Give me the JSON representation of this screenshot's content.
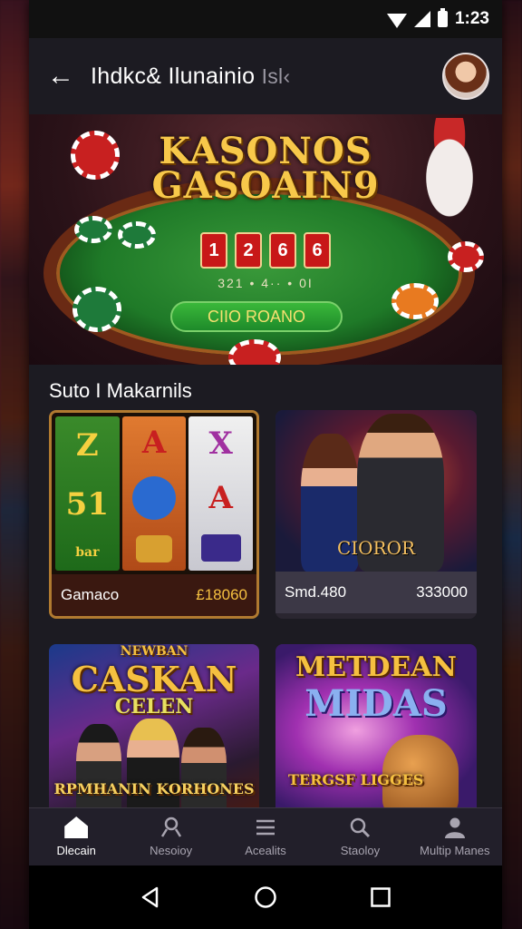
{
  "status": {
    "time": "1:23"
  },
  "appbar": {
    "title": "Ihdkc& Ilunainio",
    "title_suffix": "Isl‹"
  },
  "hero": {
    "title_line1": "KASONOS",
    "title_line2": "GASOAIN9",
    "dice": [
      "1",
      "2",
      "6",
      "6"
    ],
    "odds_text": "321 • 4·· • 0I",
    "button": "CIIO ROANO"
  },
  "section": {
    "title": "Suto I Makarnils"
  },
  "cards": [
    {
      "name": "Gamaco",
      "prize": "£18060",
      "reels": [
        [
          "Z",
          "51",
          "bar"
        ],
        [
          "A",
          "blue",
          "gold"
        ],
        [
          "X",
          "A",
          "bag"
        ]
      ]
    },
    {
      "name": "Smd.480",
      "prize": "333000",
      "label": "CIOROR"
    },
    {
      "logo_line1": "CASKAN",
      "logo_line2": "CELEN",
      "banner": "RPMHANIN KORHONES",
      "top": "NEWBAN"
    },
    {
      "logo_line1": "METDEAN",
      "logo_line2": "MIDAS",
      "banner": "TERGSF LIGGES"
    }
  ],
  "nav": [
    {
      "label": "Dlecain",
      "icon": "home-icon",
      "active": true
    },
    {
      "label": "Nesoioy",
      "icon": "slots-icon",
      "active": false
    },
    {
      "label": "Acealits",
      "icon": "list-icon",
      "active": false
    },
    {
      "label": "Staoloy",
      "icon": "search-icon",
      "active": false
    },
    {
      "label": "Multip Manes",
      "icon": "profile-icon",
      "active": false
    }
  ],
  "colors": {
    "accent": "#f5c040",
    "card_bg": "#3c3846",
    "nav_bg": "#221f2a"
  }
}
